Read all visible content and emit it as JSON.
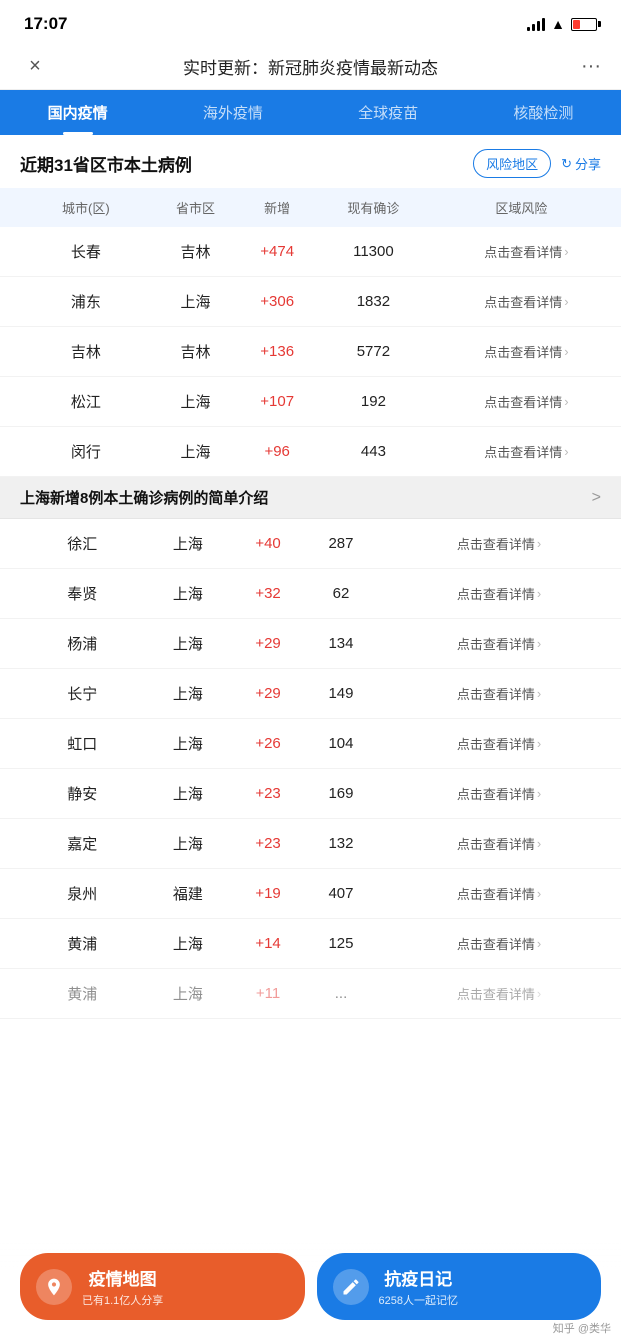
{
  "statusBar": {
    "time": "17:07"
  },
  "topNav": {
    "title": "实时更新：新冠肺炎疫情最新动态",
    "closeLabel": "×",
    "moreLabel": "···"
  },
  "tabs": [
    {
      "label": "国内疫情",
      "active": true
    },
    {
      "label": "海外疫情",
      "active": false
    },
    {
      "label": "全球疫苗",
      "active": false
    },
    {
      "label": "核酸检测",
      "active": false
    }
  ],
  "sectionTitle": "近期31省区市本土病例",
  "riskBtnLabel": "风险地区",
  "shareBtnLabel": "分享",
  "tableHeaders": [
    "城市(区)",
    "省市区",
    "新增",
    "现有确诊",
    "区域风险"
  ],
  "tableRows": [
    {
      "city": "长春",
      "province": "吉林",
      "increase": "+474",
      "confirmed": "11300",
      "detail": "点击查看详情"
    },
    {
      "city": "浦东",
      "province": "上海",
      "increase": "+306",
      "confirmed": "1832",
      "detail": "点击查看详情"
    },
    {
      "city": "吉林",
      "province": "吉林",
      "increase": "+136",
      "confirmed": "5772",
      "detail": "点击查看详情"
    },
    {
      "city": "松江",
      "province": "上海",
      "increase": "+107",
      "confirmed": "192",
      "detail": "点击查看详情"
    },
    {
      "city": "闵行",
      "province": "上海",
      "increase": "+96",
      "confirmed": "443",
      "detail": "点击查看详情"
    }
  ],
  "banner": {
    "text": "上海新增8例本土确诊病例的简单介绍",
    "chevron": ">"
  },
  "tableRows2": [
    {
      "city": "徐汇",
      "province": "上海",
      "increase": "+40",
      "confirmed": "287",
      "detail": "点击查看详情"
    },
    {
      "city": "奉贤",
      "province": "上海",
      "increase": "+32",
      "confirmed": "62",
      "detail": "点击查看详情"
    },
    {
      "city": "杨浦",
      "province": "上海",
      "increase": "+29",
      "confirmed": "134",
      "detail": "点击查看详情"
    },
    {
      "city": "长宁",
      "province": "上海",
      "increase": "+29",
      "confirmed": "149",
      "detail": "点击查看详情"
    },
    {
      "city": "虹口",
      "province": "上海",
      "increase": "+26",
      "confirmed": "104",
      "detail": "点击查看详情"
    },
    {
      "city": "静安",
      "province": "上海",
      "increase": "+23",
      "confirmed": "169",
      "detail": "点击查看详情"
    },
    {
      "city": "嘉定",
      "province": "上海",
      "increase": "+23",
      "confirmed": "132",
      "detail": "点击查看详情"
    },
    {
      "city": "泉州",
      "province": "福建",
      "increase": "+19",
      "confirmed": "407",
      "detail": "点击查看详情"
    },
    {
      "city": "黄浦",
      "province": "上海",
      "increase": "+14",
      "confirmed": "125",
      "detail": "点击查看详情"
    },
    {
      "city": "...",
      "province": "上海",
      "increase": "+11",
      "confirmed": "...",
      "detail": "点击查看详情"
    }
  ],
  "bottomBtns": {
    "map": {
      "icon": "⊕",
      "mainText": "疫情地图",
      "subText": "已有1.1亿人分享"
    },
    "diary": {
      "icon": "✎",
      "mainText": "抗疫日记",
      "subText": "6258人一起记忆"
    }
  },
  "watermark": "知乎 @类华",
  "colors": {
    "increase": "#e53935",
    "tabActive": "#1a7be5",
    "mapBtn": "#e85d2b",
    "diaryBtn": "#1a7be5"
  }
}
